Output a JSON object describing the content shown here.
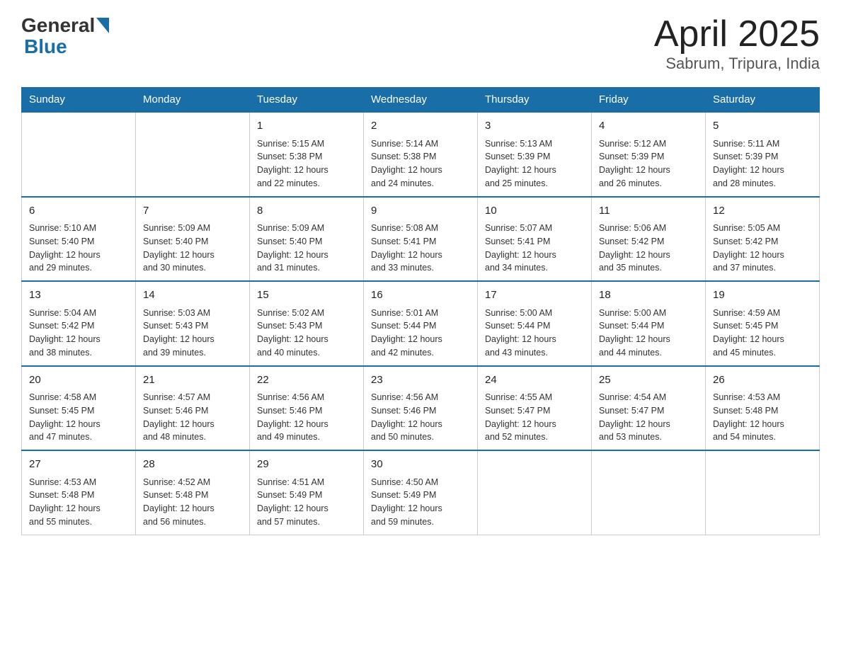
{
  "logo": {
    "general": "General",
    "blue": "Blue",
    "subtitle": "Blue"
  },
  "title": "April 2025",
  "subtitle": "Sabrum, Tripura, India",
  "weekdays": [
    "Sunday",
    "Monday",
    "Tuesday",
    "Wednesday",
    "Thursday",
    "Friday",
    "Saturday"
  ],
  "weeks": [
    [
      {
        "day": "",
        "info": ""
      },
      {
        "day": "",
        "info": ""
      },
      {
        "day": "1",
        "info": "Sunrise: 5:15 AM\nSunset: 5:38 PM\nDaylight: 12 hours\nand 22 minutes."
      },
      {
        "day": "2",
        "info": "Sunrise: 5:14 AM\nSunset: 5:38 PM\nDaylight: 12 hours\nand 24 minutes."
      },
      {
        "day": "3",
        "info": "Sunrise: 5:13 AM\nSunset: 5:39 PM\nDaylight: 12 hours\nand 25 minutes."
      },
      {
        "day": "4",
        "info": "Sunrise: 5:12 AM\nSunset: 5:39 PM\nDaylight: 12 hours\nand 26 minutes."
      },
      {
        "day": "5",
        "info": "Sunrise: 5:11 AM\nSunset: 5:39 PM\nDaylight: 12 hours\nand 28 minutes."
      }
    ],
    [
      {
        "day": "6",
        "info": "Sunrise: 5:10 AM\nSunset: 5:40 PM\nDaylight: 12 hours\nand 29 minutes."
      },
      {
        "day": "7",
        "info": "Sunrise: 5:09 AM\nSunset: 5:40 PM\nDaylight: 12 hours\nand 30 minutes."
      },
      {
        "day": "8",
        "info": "Sunrise: 5:09 AM\nSunset: 5:40 PM\nDaylight: 12 hours\nand 31 minutes."
      },
      {
        "day": "9",
        "info": "Sunrise: 5:08 AM\nSunset: 5:41 PM\nDaylight: 12 hours\nand 33 minutes."
      },
      {
        "day": "10",
        "info": "Sunrise: 5:07 AM\nSunset: 5:41 PM\nDaylight: 12 hours\nand 34 minutes."
      },
      {
        "day": "11",
        "info": "Sunrise: 5:06 AM\nSunset: 5:42 PM\nDaylight: 12 hours\nand 35 minutes."
      },
      {
        "day": "12",
        "info": "Sunrise: 5:05 AM\nSunset: 5:42 PM\nDaylight: 12 hours\nand 37 minutes."
      }
    ],
    [
      {
        "day": "13",
        "info": "Sunrise: 5:04 AM\nSunset: 5:42 PM\nDaylight: 12 hours\nand 38 minutes."
      },
      {
        "day": "14",
        "info": "Sunrise: 5:03 AM\nSunset: 5:43 PM\nDaylight: 12 hours\nand 39 minutes."
      },
      {
        "day": "15",
        "info": "Sunrise: 5:02 AM\nSunset: 5:43 PM\nDaylight: 12 hours\nand 40 minutes."
      },
      {
        "day": "16",
        "info": "Sunrise: 5:01 AM\nSunset: 5:44 PM\nDaylight: 12 hours\nand 42 minutes."
      },
      {
        "day": "17",
        "info": "Sunrise: 5:00 AM\nSunset: 5:44 PM\nDaylight: 12 hours\nand 43 minutes."
      },
      {
        "day": "18",
        "info": "Sunrise: 5:00 AM\nSunset: 5:44 PM\nDaylight: 12 hours\nand 44 minutes."
      },
      {
        "day": "19",
        "info": "Sunrise: 4:59 AM\nSunset: 5:45 PM\nDaylight: 12 hours\nand 45 minutes."
      }
    ],
    [
      {
        "day": "20",
        "info": "Sunrise: 4:58 AM\nSunset: 5:45 PM\nDaylight: 12 hours\nand 47 minutes."
      },
      {
        "day": "21",
        "info": "Sunrise: 4:57 AM\nSunset: 5:46 PM\nDaylight: 12 hours\nand 48 minutes."
      },
      {
        "day": "22",
        "info": "Sunrise: 4:56 AM\nSunset: 5:46 PM\nDaylight: 12 hours\nand 49 minutes."
      },
      {
        "day": "23",
        "info": "Sunrise: 4:56 AM\nSunset: 5:46 PM\nDaylight: 12 hours\nand 50 minutes."
      },
      {
        "day": "24",
        "info": "Sunrise: 4:55 AM\nSunset: 5:47 PM\nDaylight: 12 hours\nand 52 minutes."
      },
      {
        "day": "25",
        "info": "Sunrise: 4:54 AM\nSunset: 5:47 PM\nDaylight: 12 hours\nand 53 minutes."
      },
      {
        "day": "26",
        "info": "Sunrise: 4:53 AM\nSunset: 5:48 PM\nDaylight: 12 hours\nand 54 minutes."
      }
    ],
    [
      {
        "day": "27",
        "info": "Sunrise: 4:53 AM\nSunset: 5:48 PM\nDaylight: 12 hours\nand 55 minutes."
      },
      {
        "day": "28",
        "info": "Sunrise: 4:52 AM\nSunset: 5:48 PM\nDaylight: 12 hours\nand 56 minutes."
      },
      {
        "day": "29",
        "info": "Sunrise: 4:51 AM\nSunset: 5:49 PM\nDaylight: 12 hours\nand 57 minutes."
      },
      {
        "day": "30",
        "info": "Sunrise: 4:50 AM\nSunset: 5:49 PM\nDaylight: 12 hours\nand 59 minutes."
      },
      {
        "day": "",
        "info": ""
      },
      {
        "day": "",
        "info": ""
      },
      {
        "day": "",
        "info": ""
      }
    ]
  ]
}
